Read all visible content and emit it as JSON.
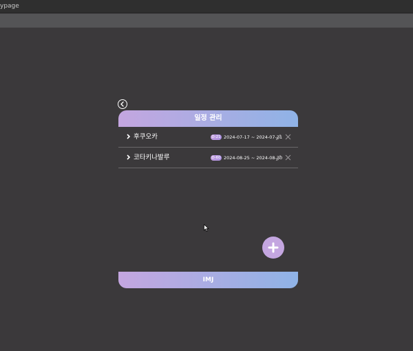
{
  "window": {
    "title": "ypage"
  },
  "header": {
    "title": "일정 관리"
  },
  "schedules": [
    {
      "name": "후쿠오카",
      "dday": "D-21",
      "dates": "2024-07-17 ~ 2024-07-21"
    },
    {
      "name": "코타키나발루",
      "dday": "D-60",
      "dates": "2024-08-25 ~ 2024-08-30"
    }
  ],
  "footer": {
    "label": "IMJ"
  },
  "icons": {
    "back": "back-circle-icon",
    "chevron": "chevron-right-icon",
    "edit": "pencil-icon",
    "delete": "close-icon",
    "add": "plus-icon"
  },
  "colors": {
    "background": "#3b393b",
    "gradient_start": "#c4a6e0",
    "gradient_end": "#8fb3e6",
    "fab": "#c4a6e0"
  }
}
